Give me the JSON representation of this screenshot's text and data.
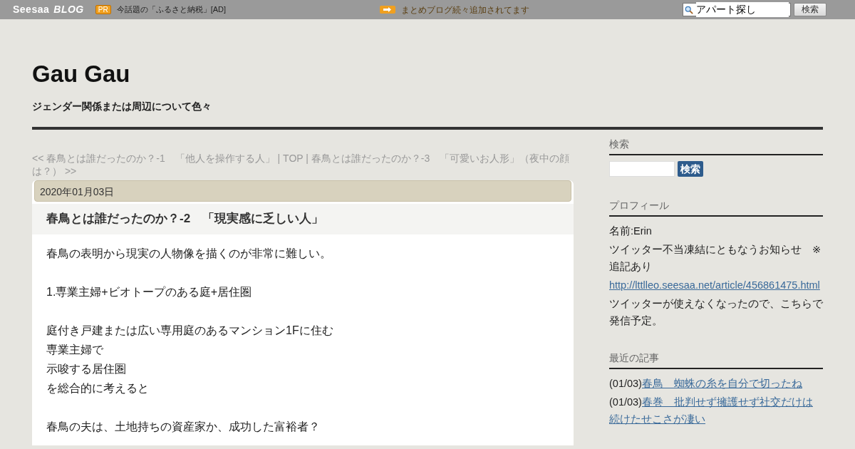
{
  "topbar": {
    "logo": "Seesaa",
    "logo_sub": "BLOG",
    "pr_badge": "PR",
    "ad_text": "今話題の「ふるさと納税」[AD]",
    "notice": "まとめブログ続々追加されてます",
    "search_value": "アパート探し",
    "search_button": "検索"
  },
  "blog": {
    "title": "Gau Gau",
    "subtitle": "ジェンダー関係または周辺について色々"
  },
  "post_nav": "<< 春鳥とは誰だったのか？-1　「他人を操作する人」 | TOP | 春鳥とは誰だったのか？-3　「可愛いお人形」（夜中の顔は？） >>",
  "article": {
    "date": "2020年01月03日",
    "title": "春鳥とは誰だったのか？-2　「現実感に乏しい人」",
    "paragraphs": [
      [
        "春鳥の表明から現実の人物像を描くのが非常に難しい。"
      ],
      [
        "1.専業主婦+ビオトープのある庭+居住圏"
      ],
      [
        "庭付き戸建または広い専用庭のあるマンション1Fに住む",
        "専業主婦で",
        "示唆する居住圏",
        "を総合的に考えると"
      ],
      [
        "春鳥の夫は、土地持ちの資産家か、成功した富裕者？"
      ]
    ]
  },
  "sidebar": {
    "search_heading": "検索",
    "search_button": "検索",
    "profile_heading": "プロフィール",
    "profile": [
      {
        "kind": "text",
        "text": "名前:Erin"
      },
      {
        "kind": "text",
        "text": "ツイッター不当凍結にともなうお知らせ　※追記あり"
      },
      {
        "kind": "link",
        "text": "http://lttlleo.seesaa.net/article/456861475.html"
      },
      {
        "kind": "text",
        "text": "ツイッターが使えなくなったので、こちらで発信予定。"
      }
    ],
    "recent_heading": "最近の記事",
    "recent": [
      {
        "date": "(01/03)",
        "title": "春鳥　蜘蛛の糸を自分で切ったね"
      },
      {
        "date": "(01/03)",
        "title": "春巻　批判せず擁護せず社交だけは続けたせこさが凄い"
      }
    ]
  }
}
